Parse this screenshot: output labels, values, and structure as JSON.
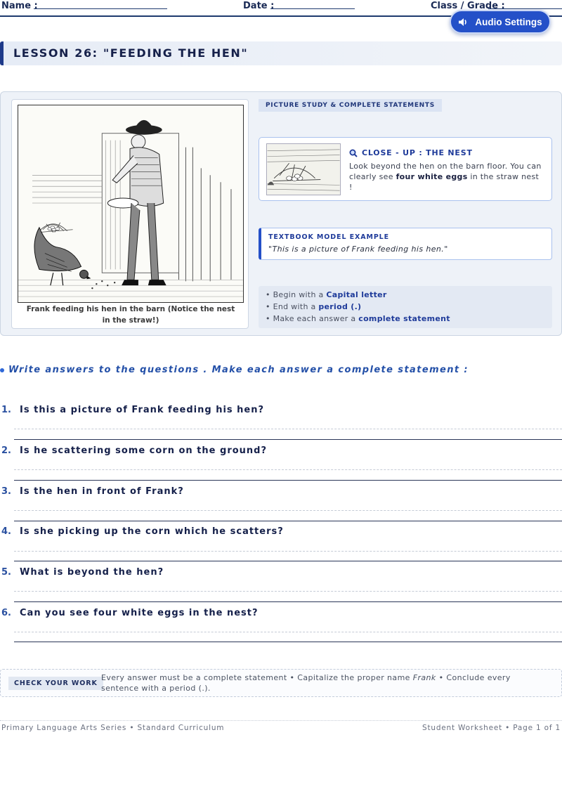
{
  "header": {
    "name_label": "Name :",
    "date_label": "Date :",
    "class_label": "Class / Grade :"
  },
  "audio_button": {
    "label": "Audio Settings",
    "icon": "speaker-icon"
  },
  "title": "LESSON 26: \"FEEDING THE HEN\"",
  "picture": {
    "caption": "Frank feeding his hen in the barn (Notice the nest in the straw!)"
  },
  "study_tag": "PICTURE STUDY & COMPLETE STATEMENTS",
  "closeup": {
    "heading": "CLOSE - UP : THE NEST",
    "icon": "magnifier-icon",
    "text_before": "Look beyond the hen on the barn floor. You can clearly see ",
    "text_bold": "four white eggs",
    "text_after": " in the straw nest !"
  },
  "model": {
    "heading": "TEXTBOOK MODEL EXAMPLE",
    "example": "\"This is a picture of Frank feeding his hen.\""
  },
  "rules": [
    {
      "prefix": "• Begin with a ",
      "highlight": "Capital letter"
    },
    {
      "prefix": "• End with a ",
      "highlight": "period (.)"
    },
    {
      "prefix": "• Make each answer a ",
      "highlight": "complete statement"
    }
  ],
  "instructions": "Write answers to the questions . Make each answer a complete statement :",
  "questions": [
    {
      "num": "1.",
      "text": "Is this a picture of Frank feeding his hen?"
    },
    {
      "num": "2.",
      "text": "Is he scattering some corn on the ground?"
    },
    {
      "num": "3.",
      "text": "Is the hen in front of Frank?"
    },
    {
      "num": "4.",
      "text": "Is she picking up the corn which he scatters?"
    },
    {
      "num": "5.",
      "text": "What is beyond the hen?"
    },
    {
      "num": "6.",
      "text": "Can you see four white eggs in the nest?"
    }
  ],
  "check": {
    "label": "CHECK YOUR WORK",
    "text_before": "Every answer must be a complete statement • Capitalize the proper name ",
    "text_italic": "Frank",
    "text_after": " • Conclude every sentence with a period (.)."
  },
  "footer": {
    "left": "Primary Language Arts Series • Standard Curriculum",
    "right": "Student Worksheet • Page 1 of 1"
  }
}
